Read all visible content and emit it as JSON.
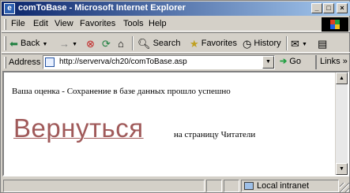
{
  "window": {
    "title": "comToBase - Microsoft Internet Explorer",
    "minimize": "_",
    "maximize": "□",
    "close": "×"
  },
  "menubar": {
    "items": [
      "File",
      "Edit",
      "View",
      "Favorites",
      "Tools",
      "Help"
    ]
  },
  "toolbar": {
    "back_label": "Back",
    "forward_icon": "→",
    "stop_icon": "⊗",
    "refresh_icon": "⟳",
    "home_icon": "⌂",
    "search_label": "Search",
    "favorites_label": "Favorites",
    "history_label": "History",
    "mail_icon": "✉",
    "print_icon": "▤"
  },
  "addressbar": {
    "label": "Address",
    "url": "http://serverva/ch20/comToBase.asp",
    "dropdown_icon": "▼",
    "go_label": "Go",
    "links_label": "Links"
  },
  "content": {
    "message": "Ваша оценка - Сохранение в базе данных прошло успешно",
    "back_link": "Вернуться",
    "back_suffix": "на страницу Читатели"
  },
  "statusbar": {
    "zone": "Local intranet"
  },
  "colors": {
    "titlebar_start": "#0a246a",
    "titlebar_end": "#a6caf0",
    "link_visited": "#a05a5a"
  }
}
